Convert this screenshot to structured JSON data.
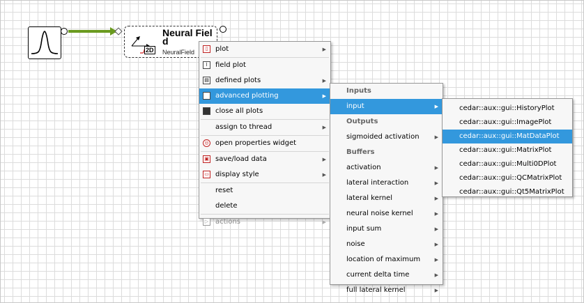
{
  "canvas": {
    "grid_color": "#dcdcdc",
    "connection_color": "#6a9a1f"
  },
  "field_node": {
    "title": "Neural Field",
    "title_line1": "Neural Fiel",
    "title_line2": "d",
    "class_name": "NeuralField",
    "dimension_badge": "2D"
  },
  "context_menu": {
    "items": [
      {
        "label": "plot",
        "icon": "plot-icon",
        "submenu": true
      },
      {
        "label": "field plot",
        "icon": "field-plot-icon",
        "submenu": false
      },
      {
        "label": "defined plots",
        "icon": "defined-plots-icon",
        "submenu": true
      },
      {
        "label": "advanced plotting",
        "icon": "advanced-plotting-icon",
        "submenu": true,
        "highlighted": true
      },
      {
        "label": "close all plots",
        "icon": "close-plots-icon",
        "submenu": false
      },
      {
        "label": "assign to thread",
        "icon": null,
        "submenu": true
      },
      {
        "label": "open properties widget",
        "icon": "properties-icon",
        "submenu": false
      },
      {
        "label": "save/load data",
        "icon": "save-load-icon",
        "submenu": true
      },
      {
        "label": "display style",
        "icon": "display-style-icon",
        "submenu": true
      },
      {
        "label": "reset",
        "icon": null,
        "submenu": false
      },
      {
        "label": "delete",
        "icon": null,
        "submenu": false
      },
      {
        "label": "actions",
        "icon": "actions-icon",
        "submenu": true,
        "disabled": true
      }
    ]
  },
  "data_menu": {
    "sections": {
      "inputs": "Inputs",
      "outputs": "Outputs",
      "buffers": "Buffers"
    },
    "inputs": [
      "input"
    ],
    "outputs": [
      "sigmoided activation"
    ],
    "buffers": [
      "activation",
      "lateral interaction",
      "lateral kernel",
      "neural noise kernel",
      "input sum",
      "noise",
      "location of maximum",
      "current delta time",
      "full lateral kernel"
    ]
  },
  "plot_menu": {
    "items": [
      "cedar::aux::gui::HistoryPlot",
      "cedar::aux::gui::ImagePlot",
      "cedar::aux::gui::MatDataPlot",
      "cedar::aux::gui::MatrixPlot",
      "cedar::aux::gui::Multi0DPlot",
      "cedar::aux::gui::QCMatrixPlot",
      "cedar::aux::gui::Qt5MatrixPlot"
    ],
    "highlighted": "cedar::aux::gui::MatDataPlot"
  },
  "colors": {
    "highlight": "#3398dd",
    "menu_bg": "#f7f7f7"
  }
}
